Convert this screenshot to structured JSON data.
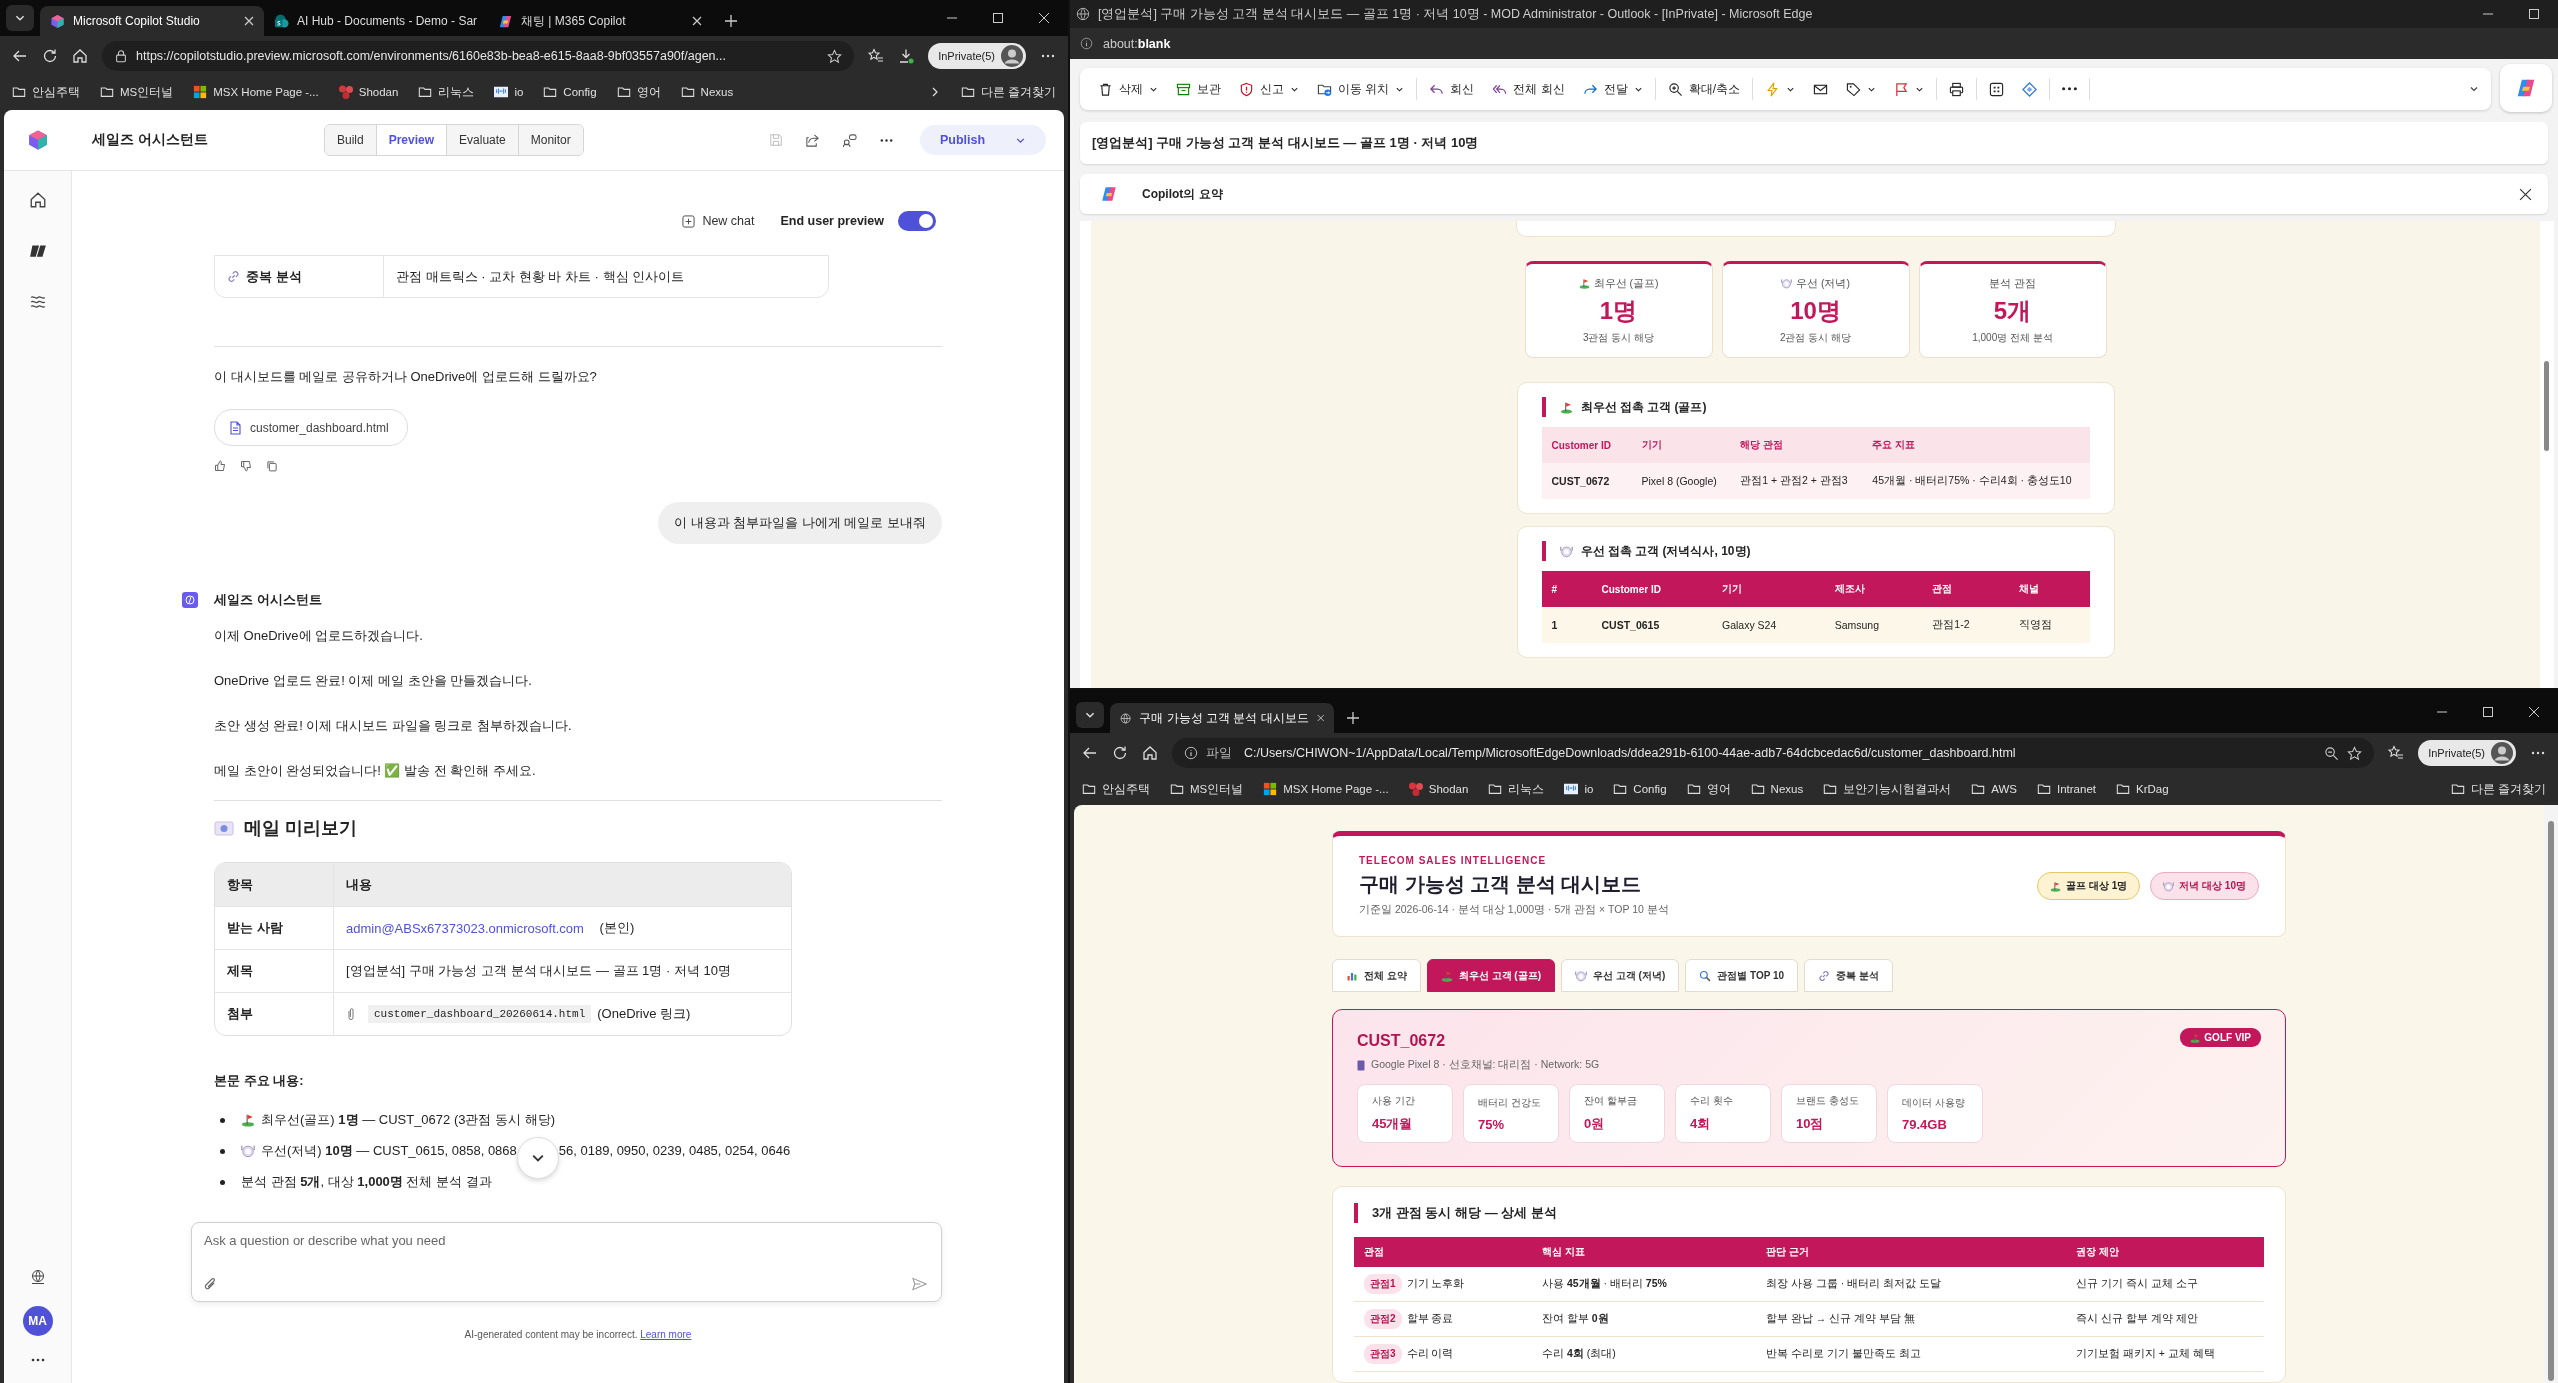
{
  "left_window": {
    "tabs": [
      {
        "kind": "studio",
        "title": "Microsoft Copilot Studio",
        "selected": true
      },
      {
        "kind": "sharepoint",
        "title": "AI Hub - Documents - Demo - Sar",
        "selected": false
      },
      {
        "kind": "copilot",
        "title": "채팅 | M365 Copilot",
        "selected": false
      }
    ],
    "url": "https://copilotstudio.preview.microsoft.com/environments/6160e83b-bea8-e615-8aa8-9bf03557a90f/agen...",
    "profile": "InPrivate(5)",
    "bookmarks": [
      {
        "kind": "folder",
        "label": "안심주택"
      },
      {
        "kind": "folder",
        "label": "MS인터널"
      },
      {
        "kind": "ms",
        "label": "MSX Home Page -..."
      },
      {
        "kind": "shodan",
        "label": "Shodan"
      },
      {
        "kind": "folder",
        "label": "리눅스"
      },
      {
        "kind": "cisco",
        "label": "io"
      },
      {
        "kind": "folder",
        "label": "Config"
      },
      {
        "kind": "folder",
        "label": "영어"
      },
      {
        "kind": "folder",
        "label": "Nexus"
      }
    ],
    "other_bookmarks": "다른 즐겨찾기",
    "agent_name": "세일즈 어시스턴트",
    "modes": [
      {
        "label": "Build",
        "selected": false
      },
      {
        "label": "Preview",
        "selected": true
      },
      {
        "label": "Evaluate",
        "selected": false
      },
      {
        "label": "Monitor",
        "selected": false
      }
    ],
    "publish": "Publish",
    "avatar": "MA",
    "chat": {
      "new_chat": "New chat",
      "preview_label": "End user preview",
      "preview_on": true,
      "prev_row": [
        "중복 분석",
        "관점 매트릭스 · 교차 현황 바 차트 · 핵심 인사이트"
      ],
      "question": "이 대시보드를 메일로 공유하거나 OneDrive에 업로드해 드릴까요?",
      "file": "customer_dashboard.html",
      "user_message": "이 내용과 첨부파일을 나에게 메일로 보내줘",
      "assistant_name": "세일즈 어시스턴트",
      "messages": [
        "이제 OneDrive에 업로드하겠습니다.",
        "OneDrive 업로드 완료! 이제 메일 초안을 만들겠습니다.",
        "초안 생성 완료! 이제 대시보드 파일을 링크로 첨부하겠습니다.",
        "메일 초안이 완성되었습니다! ✅ 발송 전 확인해 주세요."
      ],
      "preview_heading": "메일 미리보기",
      "mail_columns": [
        "항목",
        "내용"
      ],
      "mail_rows": [
        {
          "kind": "recipient",
          "label": "받는 사람",
          "link": "admin@ABSx67373023.onmicrosoft.com",
          "text": "(본인)"
        },
        {
          "kind": "text",
          "label": "제목",
          "text": "[영업분석] 구매 가능성 고객 분석 대시보드 — 골프 1명 · 저녁 10명"
        },
        {
          "kind": "attachment",
          "label": "첨부",
          "code": "customer_dashboard_20260614.html",
          "text": "(OneDrive 링크)"
        }
      ],
      "body_heading": "본문 주요 내용:",
      "bullets": [
        {
          "kind": "golf",
          "text": "최우선(골프) **1명** — CUST_0672 (3관점 동시 해당)"
        },
        {
          "kind": "dinner",
          "text": "우선(저녁) **10명** — CUST_0615, 0858, 0868",
          "text_after": "56, 0189, 0950, 0239, 0485, 0254, 0646"
        },
        {
          "text": "분석 관점 **5개**, 대상 **1,000명** 전체 분석 결과"
        }
      ],
      "placeholder": "Ask a question or describe what you need",
      "disclaimer": "AI-generated content may be incorrect.",
      "learn_more": "Learn more"
    }
  },
  "outlook_window": {
    "title": "[영업분석] 구매 가능성 고객 분석 대시보드 — 골프 1명 · 저녁 10명 - MOD Administrator - Outlook - [InPrivate] - Microsoft Edge",
    "address": "about:**blank**",
    "toolbar": [
      {
        "kind": "trash",
        "label": "삭제",
        "dropdown": true
      },
      {
        "kind": "archive",
        "label": "보관",
        "dropdown": false
      },
      {
        "kind": "shield",
        "label": "신고",
        "dropdown": true
      },
      {
        "kind": "move",
        "label": "이동 위치",
        "dropdown": true
      },
      {
        "kind": "reply",
        "label": "회신",
        "dropdown": false
      },
      {
        "kind": "replyall",
        "label": "전체 회신",
        "dropdown": false
      },
      {
        "kind": "forward",
        "label": "전달",
        "dropdown": true
      },
      {
        "kind": "zoom",
        "label": "확대/축소",
        "dropdown": false
      },
      {
        "kind": "bolt",
        "dropdown": true
      },
      {
        "kind": "mail",
        "dropdown": false
      },
      {
        "kind": "tag",
        "dropdown": true
      },
      {
        "kind": "flag",
        "dropdown": true
      },
      {
        "kind": "print",
        "dropdown": false
      },
      {
        "kind": "apps",
        "dropdown": false
      },
      {
        "kind": "diamond",
        "dropdown": false
      },
      {
        "kind": "more",
        "dropdown": false
      }
    ],
    "subject": "[영업분석] 구매 가능성 고객 분석 대시보드 — 골프 1명 · 저녁 10명",
    "summary": "Copilot의 요약",
    "stats": [
      {
        "kind": "golf",
        "label": "최우선 (골프)",
        "value": "1명",
        "note": "3관점 동시 해당"
      },
      {
        "kind": "dinner",
        "label": "우선 (저녁)",
        "value": "10명",
        "note": "2관점 동시 해당"
      },
      {
        "label": "분석 관점",
        "value": "5개",
        "note": "1,000명 전체 분석"
      }
    ],
    "golf_section": {
      "kind": "golf",
      "title": "최우선 접촉 고객 (골프)",
      "columns": [
        "Customer ID",
        "기기",
        "해당 관점",
        "주요 지표"
      ],
      "rows": [
        [
          "CUST_0672",
          "Pixel 8 (Google)",
          "관점1 + 관점2 + 관점3",
          "45개월 · 배터리75% · 수리4회 · 충성도10"
        ]
      ]
    },
    "dinner_section": {
      "kind": "dinner",
      "title": "우선 접촉 고객 (저녁식사, 10명)",
      "columns": [
        "#",
        "Customer ID",
        "기기",
        "제조사",
        "관점",
        "채널"
      ],
      "rows": [
        [
          "1",
          "CUST_0615",
          "Galaxy S24",
          "Samsung",
          "관점1-2",
          "직영점"
        ]
      ]
    }
  },
  "dashboard_window": {
    "tab": "구매 가능성 고객 분석 대시보드",
    "address_prefix": "파일",
    "url": "C:/Users/CHIWON~1/AppData/Local/Temp/MicrosoftEdgeDownloads/ddea291b-6100-44ae-adb7-64dcbcedac6d/customer_dashboard.html",
    "profile": "InPrivate(5)",
    "bookmarks": [
      {
        "kind": "folder",
        "label": "안심주택"
      },
      {
        "kind": "folder",
        "label": "MS인터널"
      },
      {
        "kind": "ms",
        "label": "MSX Home Page -..."
      },
      {
        "kind": "shodan",
        "label": "Shodan"
      },
      {
        "kind": "folder",
        "label": "리눅스"
      },
      {
        "kind": "cisco",
        "label": "io"
      },
      {
        "kind": "folder",
        "label": "Config"
      },
      {
        "kind": "folder",
        "label": "영어"
      },
      {
        "kind": "folder",
        "label": "Nexus"
      },
      {
        "kind": "folder",
        "label": "보안기능시험결과서"
      },
      {
        "kind": "folder",
        "label": "AWS"
      },
      {
        "kind": "folder",
        "label": "Intranet"
      },
      {
        "kind": "folder",
        "label": "KrDag"
      }
    ],
    "other_bookmarks": "다른 즐겨찾기",
    "eyebrow": "TELECOM SALES INTELLIGENCE",
    "title": "구매 가능성 고객 분석 대시보드",
    "meta": "기준일 2026-06-14 · 분석 대상 1,000명 · 5개 관점 × TOP 10 분석",
    "badges": [
      {
        "kind": "golf",
        "label": "골프 대상 1명",
        "color": "#fdf3d2"
      },
      {
        "kind": "dinner",
        "label": "저녁 대상 10명",
        "color": "#fbe1ea"
      }
    ],
    "tabs": [
      {
        "kind": "chart",
        "label": "전체 요약",
        "selected": false
      },
      {
        "kind": "golf",
        "label": "최우선 고객 (골프)",
        "selected": true
      },
      {
        "kind": "dinner",
        "label": "우선 고객 (저녁)",
        "selected": false
      },
      {
        "kind": "search",
        "label": "관점별 TOP 10",
        "selected": false
      },
      {
        "kind": "link",
        "label": "중복 분석",
        "selected": false
      }
    ],
    "customer": {
      "id": "CUST_0672",
      "badge": "GOLF VIP",
      "meta": "Google Pixel 8 · 선호채널: 대리점 · Network: 5G",
      "metrics": [
        {
          "label": "사용 기간",
          "value": "45개월"
        },
        {
          "label": "배터리 건강도",
          "value": "75%"
        },
        {
          "label": "잔여 할부금",
          "value": "0원"
        },
        {
          "label": "수리 횟수",
          "value": "4회"
        },
        {
          "label": "브랜드 충성도",
          "value": "10점"
        },
        {
          "label": "데이터 사용량",
          "value": "79.4GB"
        }
      ]
    },
    "detail": {
      "title": "3개 관점 동시 해당 — 상세 분석",
      "columns": [
        "관점",
        "핵심 지표",
        "판단 근거",
        "권장 제안"
      ],
      "rows": [
        {
          "tag": "관점1",
          "name": "기기 노후화",
          "metric": "사용 **45개월** · 배터리 **75%**",
          "reason": "최장 사용 그룹 · 배터리 최저값 도달",
          "offer": "신규 기기 즉시 교체 소구"
        },
        {
          "tag": "관점2",
          "name": "할부 종료",
          "metric": "잔여 할부 **0원**",
          "reason": "할부 완납 → 신규 계약 부담 無",
          "offer": "즉시 신규 할부 계약 제안"
        },
        {
          "tag": "관점3",
          "name": "수리 이력",
          "metric": "수리 **4회** (최대)",
          "reason": "반복 수리로 기기 불만족도 최고",
          "offer": "기기보험 패키지 + 교체 혜택"
        }
      ]
    }
  }
}
